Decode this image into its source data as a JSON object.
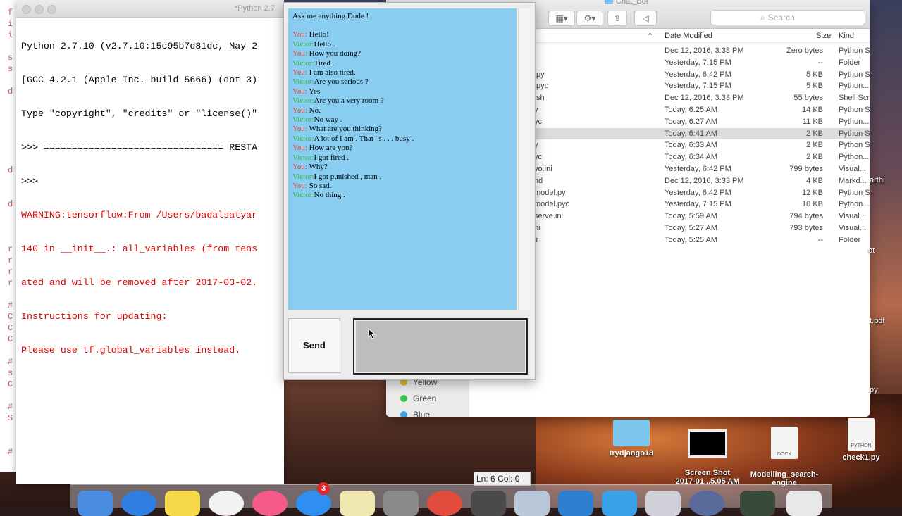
{
  "finder": {
    "title": "Chat_Bot",
    "search_placeholder": "Search",
    "columns": {
      "name": "",
      "date": "Date Modified",
      "size": "Size",
      "kind": "Kind"
    },
    "rows": [
      {
        "name": "",
        "date": "Dec 12, 2016, 3:33 PM",
        "size": "Zero bytes",
        "kind": "Python S"
      },
      {
        "name": "",
        "date": "Yesterday, 7:15 PM",
        "size": "--",
        "kind": "Folder"
      },
      {
        "name": ".py",
        "date": "Yesterday, 6:42 PM",
        "size": "5 KB",
        "kind": "Python S"
      },
      {
        "name": ".pyc",
        "date": "Yesterday, 7:15 PM",
        "size": "5 KB",
        "kind": "Python..."
      },
      {
        "name": ".sh",
        "date": "Dec 12, 2016, 3:33 PM",
        "size": "55 bytes",
        "kind": "Shell Scr"
      },
      {
        "name": "y",
        "date": "Today, 6:25 AM",
        "size": "14 KB",
        "kind": "Python S"
      },
      {
        "name": "yc",
        "date": "Today, 6:27 AM",
        "size": "11 KB",
        "kind": "Python..."
      },
      {
        "name": "",
        "date": "Today, 6:41 AM",
        "size": "2 KB",
        "kind": "Python S"
      },
      {
        "name": "y",
        "date": "Today, 6:33 AM",
        "size": "2 KB",
        "kind": "Python S"
      },
      {
        "name": "yc",
        "date": "Today, 6:34 AM",
        "size": "2 KB",
        "kind": "Python..."
      },
      {
        "name": "vo.ini",
        "date": "Yesterday, 6:42 PM",
        "size": "799 bytes",
        "kind": "Visual..."
      },
      {
        "name": "nd",
        "date": "Dec 12, 2016, 3:33 PM",
        "size": "4 KB",
        "kind": "Markd..."
      },
      {
        "name": "model.py",
        "date": "Yesterday, 6:42 PM",
        "size": "12 KB",
        "kind": "Python S"
      },
      {
        "name": "model.pyc",
        "date": "Yesterday, 7:15 PM",
        "size": "10 KB",
        "kind": "Python..."
      },
      {
        "name": "serve.ini",
        "date": "Today, 5:59 AM",
        "size": "794 bytes",
        "kind": "Visual..."
      },
      {
        "name": "ni",
        "date": "Today, 5:27 AM",
        "size": "793 bytes",
        "kind": "Visual..."
      },
      {
        "name": "ir",
        "date": "Today, 5:25 AM",
        "size": "--",
        "kind": "Folder"
      }
    ],
    "tags": [
      {
        "label": "Yellow",
        "color": "#e0b42a"
      },
      {
        "label": "Green",
        "color": "#36c24a"
      },
      {
        "label": "Blue",
        "color": "#3a9fe8"
      }
    ]
  },
  "idle": {
    "title": "*Python 2.7",
    "lines": [
      "Python 2.7.10 (v2.7.10:15c95b7d81dc, May 2",
      "[GCC 4.2.1 (Apple Inc. build 5666) (dot 3)",
      "Type \"copyright\", \"credits\" or \"license()\"",
      ">>> ================================ RESTA",
      ">>>"
    ],
    "warning_lines": [
      "WARNING:tensorflow:From /Users/badalsatyar",
      "140 in __init__.: all_variables (from tens",
      "ated and will be removed after 2017-03-02.",
      "Instructions for updating:",
      "Please use tf.global_variables instead."
    ],
    "status": "Ln: 6  Col: 0",
    "side_fragments": "f\ni\ni\n\ns\ns\n\nd\n\n\n\n\n\n\nd\n\n\nd\n\n\n\nr\nr\nr\nr\n\n#\nC\nC\nC\n\n#\ns\nC\n\n#\nS\n\n\n#"
  },
  "chat": {
    "greeting": "Ask me anything Dude !",
    "messages": [
      {
        "speaker": "You:",
        "text": " Hello!"
      },
      {
        "speaker": "Victor:",
        "text": "Hello ."
      },
      {
        "speaker": "You:",
        "text": " How you doing?"
      },
      {
        "speaker": "Victor:",
        "text": "Tired ."
      },
      {
        "speaker": "You:",
        "text": " I am also tired."
      },
      {
        "speaker": "Victor:",
        "text": "Are you serious ?"
      },
      {
        "speaker": "You:",
        "text": " Yes"
      },
      {
        "speaker": "Victor:",
        "text": "Are you a very room ?"
      },
      {
        "speaker": "You:",
        "text": " No."
      },
      {
        "speaker": "Victor:",
        "text": "No way ."
      },
      {
        "speaker": "You:",
        "text": " What are you thinking?"
      },
      {
        "speaker": "Victor:",
        "text": "A lot of I am . That ' s . . . busy ."
      },
      {
        "speaker": "You:",
        "text": " How are you?"
      },
      {
        "speaker": "Victor:",
        "text": "I got fired ."
      },
      {
        "speaker": "You:",
        "text": " Why?"
      },
      {
        "speaker": "Victor:",
        "text": "I got punished , man ."
      },
      {
        "speaker": "You:",
        "text": " So sad."
      },
      {
        "speaker": "Victor:",
        "text": "No thing ."
      }
    ],
    "send_label": "Send",
    "input_value": ""
  },
  "desktop": {
    "icons": [
      {
        "label": "trydjango18",
        "type": "folder"
      },
      {
        "label": "Screen Shot\n2017-01...5.05 AM",
        "type": "screenshot"
      },
      {
        "label": "Modelling_search-\nengine",
        "type": "doc",
        "badge": "DOCX"
      },
      {
        "label": "check1.py",
        "type": "doc",
        "badge": "PYTHON"
      }
    ],
    "right_edge": [
      "arthi",
      "ot",
      "t.pdf",
      "py"
    ]
  },
  "dock": {
    "notification_badge": "3"
  }
}
